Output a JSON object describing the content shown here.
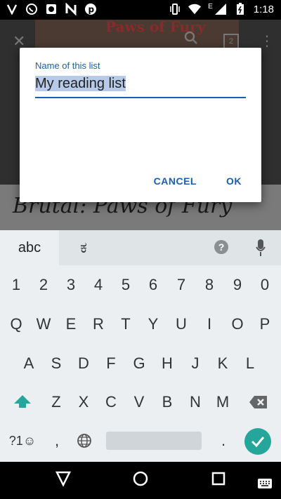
{
  "status_bar": {
    "time": "1:18",
    "network_indicator": "E",
    "left_icons": [
      "v-app-icon",
      "whatsapp-icon",
      "messaging-icon",
      "notification-n-icon",
      "pinterest-icon"
    ],
    "right_icons": [
      "vibrate-icon",
      "wifi-icon",
      "signal-icon",
      "battery-icon"
    ]
  },
  "app_background": {
    "book_title": "Brutal: Paws of Fury",
    "cover_title": "Paws of Fury",
    "tab_count": "2"
  },
  "dialog": {
    "label": "Name of this list",
    "value": "My reading list",
    "cancel_label": "CANCEL",
    "ok_label": "OK",
    "accent_color": "#1a5fb4"
  },
  "keyboard": {
    "mode_label": "abc",
    "language_key": "ಕ",
    "number_row": [
      "1",
      "2",
      "3",
      "4",
      "5",
      "6",
      "7",
      "8",
      "9",
      "0"
    ],
    "row1": [
      "Q",
      "W",
      "E",
      "R",
      "T",
      "Y",
      "U",
      "I",
      "O",
      "P"
    ],
    "row2": [
      "A",
      "S",
      "D",
      "F",
      "G",
      "H",
      "J",
      "K",
      "L"
    ],
    "row3": [
      "Z",
      "X",
      "C",
      "V",
      "B",
      "N",
      "M"
    ],
    "symbols_label": "?1☺",
    "comma": ",",
    "period": ".",
    "accent_color": "#26a69a"
  }
}
